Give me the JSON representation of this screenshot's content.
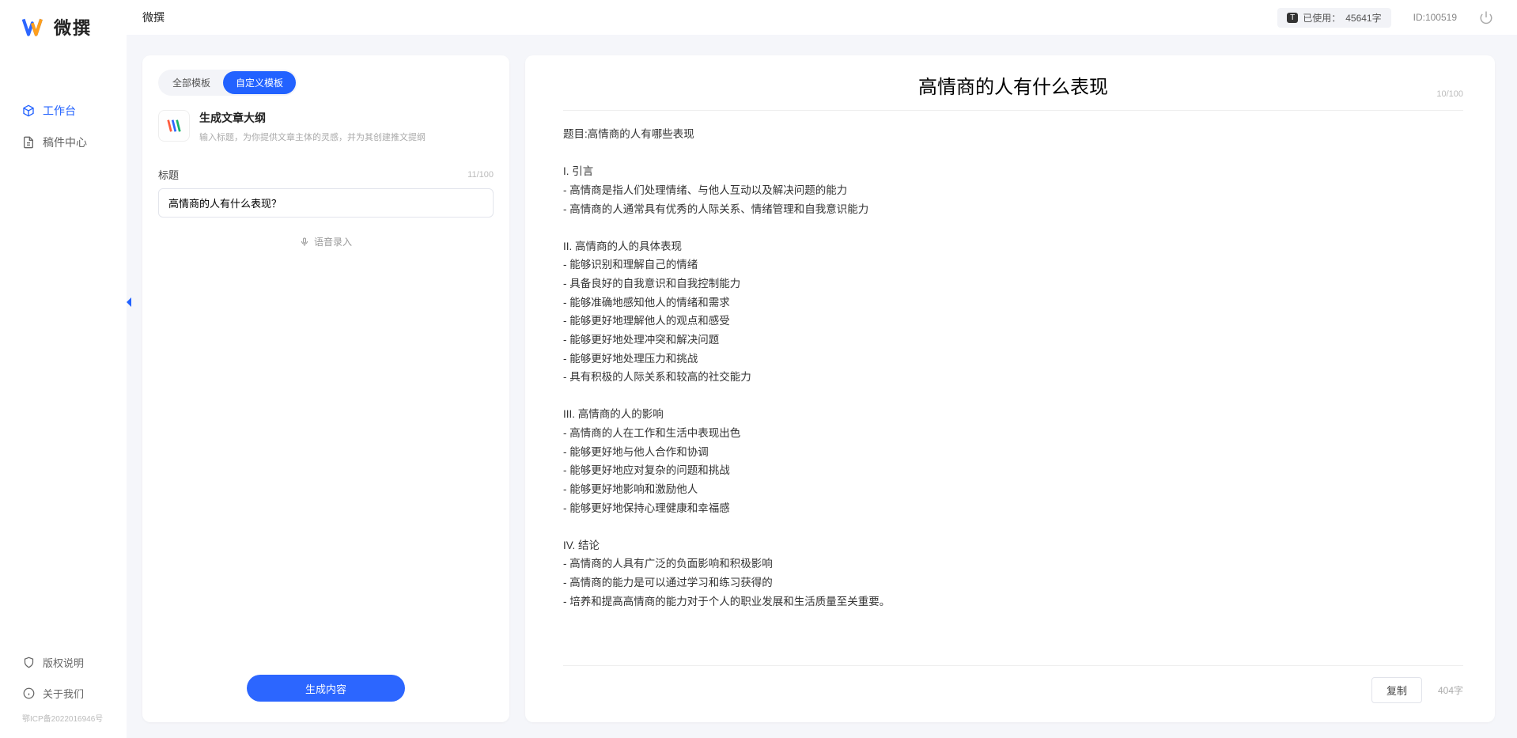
{
  "app": {
    "logo_text": "微撰",
    "name": "微撰"
  },
  "topbar": {
    "usage_label": "已使用：",
    "usage_value": "45641字",
    "id_label": "ID:100519"
  },
  "sidebar": {
    "nav": [
      {
        "label": "工作台",
        "icon": "cube-icon",
        "active": true
      },
      {
        "label": "稿件中心",
        "icon": "doc-icon",
        "active": false
      }
    ],
    "bottom": [
      {
        "label": "版权说明",
        "icon": "shield-icon"
      },
      {
        "label": "关于我们",
        "icon": "info-icon"
      }
    ],
    "icp": "鄂ICP备2022016946号"
  },
  "left_panel": {
    "tabs": [
      {
        "label": "全部模板",
        "active": false
      },
      {
        "label": "自定义模板",
        "active": true
      }
    ],
    "template": {
      "title": "生成文章大纲",
      "desc": "输入标题，为你提供文章主体的灵感，并为其创建推文提纲"
    },
    "field": {
      "label": "标题",
      "counter": "11/100",
      "value": "高情商的人有什么表现？"
    },
    "voice_link": "语音录入",
    "generate_btn": "生成内容"
  },
  "right_panel": {
    "title": "高情商的人有什么表现",
    "title_counter": "10/100",
    "body": "题目:高情商的人有哪些表现\n\nI. 引言\n- 高情商是指人们处理情绪、与他人互动以及解决问题的能力\n- 高情商的人通常具有优秀的人际关系、情绪管理和自我意识能力\n\nII. 高情商的人的具体表现\n- 能够识别和理解自己的情绪\n- 具备良好的自我意识和自我控制能力\n- 能够准确地感知他人的情绪和需求\n- 能够更好地理解他人的观点和感受\n- 能够更好地处理冲突和解决问题\n- 能够更好地处理压力和挑战\n- 具有积极的人际关系和较高的社交能力\n\nIII. 高情商的人的影响\n- 高情商的人在工作和生活中表现出色\n- 能够更好地与他人合作和协调\n- 能够更好地应对复杂的问题和挑战\n- 能够更好地影响和激励他人\n- 能够更好地保持心理健康和幸福感\n\nIV. 结论\n- 高情商的人具有广泛的负面影响和积极影响\n- 高情商的能力是可以通过学习和练习获得的\n- 培养和提高高情商的能力对于个人的职业发展和生活质量至关重要。",
    "copy_btn": "复制",
    "word_count": "404字"
  }
}
